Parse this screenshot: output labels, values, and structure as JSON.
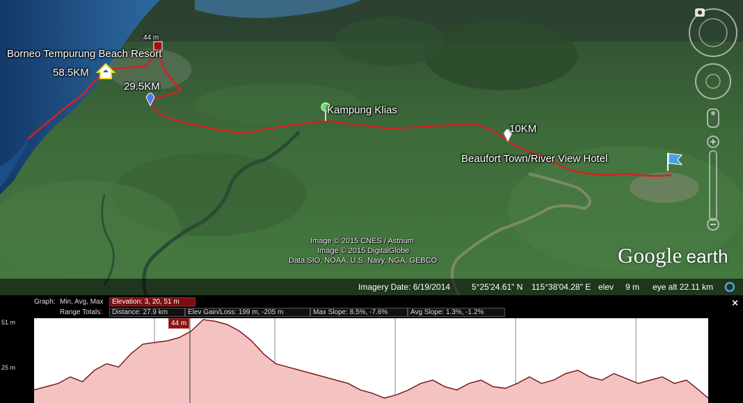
{
  "map": {
    "labels": {
      "resort": "Borneo Tempurung Beach Resort",
      "km585": "58.5KM",
      "km295": "29.5KM",
      "m44": "44 m",
      "klias": "Kampung Klias",
      "km10": "10KM",
      "beaufort": "Beaufort Town/River View Hotel"
    },
    "credits": {
      "cnes": "Image © 2015 CNES / Astrium",
      "digitalglobe": "Image © 2015 DigitalGlobe",
      "data": "Data SIO, NOAA, U.S. Navy, NGA, GEBCO"
    },
    "logo": {
      "google": "Google",
      "earth": "earth"
    },
    "colors": {
      "route": "#d42222",
      "sea": "#1f4f86",
      "land": "#3f6b3c"
    }
  },
  "status": {
    "imagery_date": "Imagery Date: 6/19/2014",
    "lat": "5°25'24.61\" N",
    "lon": "115°38'04.28\" E",
    "elev_label": "elev",
    "elev_value": "9 m",
    "eye_alt": "eye alt  22.11 km"
  },
  "profile": {
    "graph_label": "Graph:",
    "graph_options": "Min, Avg, Max",
    "elevation": "Elevation: 3, 20, 51 m",
    "range_label": "Range Totals:",
    "distance": "Distance: 27.9 km",
    "elev_gain": "Elev Gain/Loss: 199 m, -205 m",
    "max_slope": "Max Slope: 8.5%, -7.6%",
    "avg_slope": "Avg Slope: 1.3%, -1.2%",
    "cursor": "44 m",
    "close": "×",
    "y_ticks": [
      "51 m",
      "25 m"
    ]
  },
  "chart_data": {
    "type": "area",
    "title": "",
    "xlabel": "",
    "ylabel": "",
    "ylim": [
      0,
      51
    ],
    "x": [
      0,
      0.5,
      1,
      1.5,
      2,
      2.5,
      3,
      3.5,
      4,
      4.5,
      5,
      5.5,
      6,
      6.5,
      7,
      7.5,
      8,
      8.5,
      9,
      9.5,
      10,
      10.5,
      11,
      11.5,
      12,
      12.5,
      13,
      13.5,
      14,
      14.5,
      15,
      15.5,
      16,
      16.5,
      17,
      17.5,
      18,
      18.5,
      19,
      19.5,
      20,
      20.5,
      21,
      21.5,
      22,
      22.5,
      23,
      23.5,
      24,
      24.5,
      25,
      25.5,
      26,
      26.5,
      27,
      27.5,
      27.9
    ],
    "series": [
      {
        "values": [
          8,
          10,
          12,
          16,
          13,
          20,
          24,
          22,
          30,
          36,
          37,
          38,
          40,
          44,
          51,
          50,
          48,
          44,
          38,
          30,
          24,
          22,
          20,
          18,
          16,
          14,
          12,
          8,
          6,
          3,
          5,
          8,
          12,
          14,
          10,
          8,
          12,
          14,
          10,
          9,
          12,
          16,
          12,
          14,
          18,
          20,
          16,
          14,
          18,
          15,
          12,
          14,
          16,
          12,
          14,
          8,
          3
        ]
      }
    ]
  }
}
